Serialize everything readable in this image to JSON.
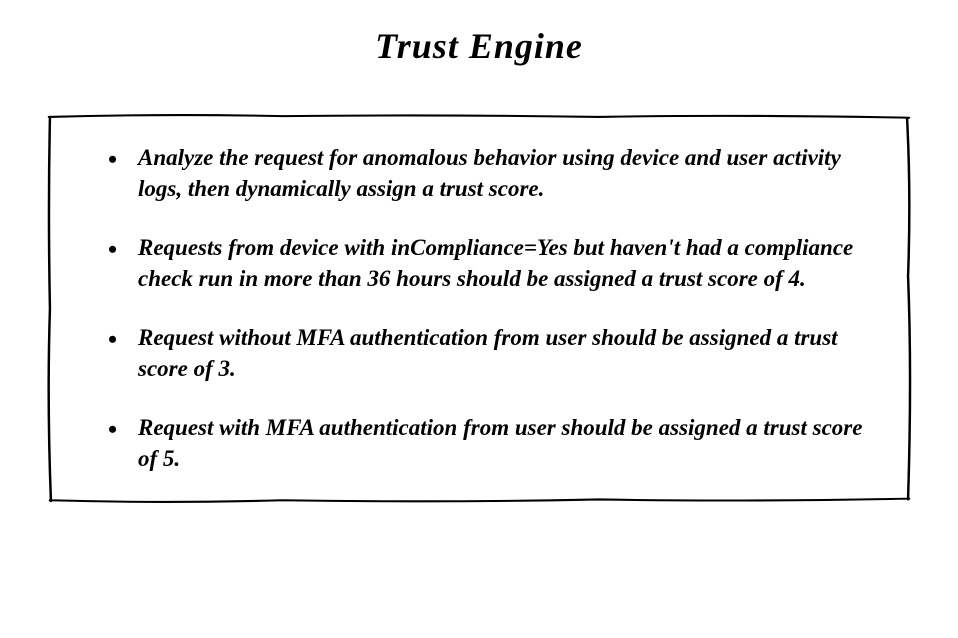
{
  "title": "Trust Engine",
  "bullets": [
    "Analyze the request for anomalous behavior using device and user activity logs, then dynamically assign a trust score.",
    "Requests from device with inCompliance=Yes but haven't had a compliance check run in more than 36 hours should be assigned a trust score of 4.",
    "Request without MFA authentication from user should be assigned a trust score of 3.",
    "Request with MFA authentication from user should be assigned a trust score of 5."
  ]
}
